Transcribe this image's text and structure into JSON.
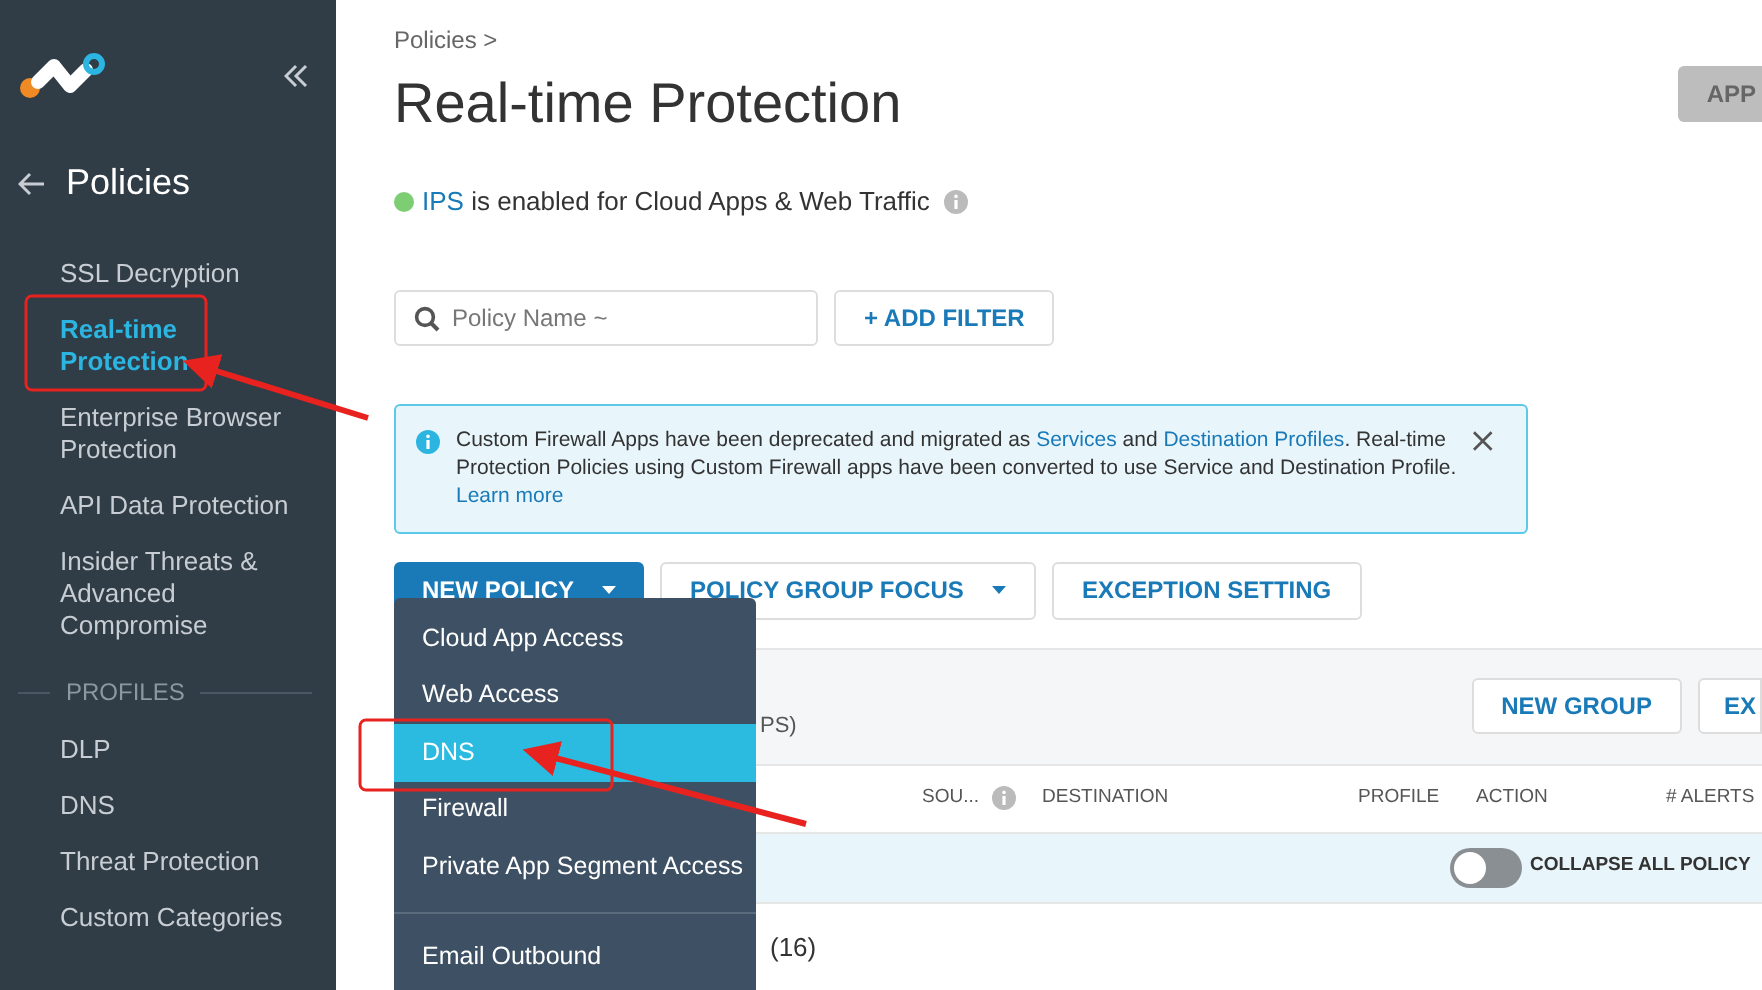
{
  "sidebar": {
    "section_title": "Policies",
    "items": [
      {
        "label": "SSL Decryption",
        "selected": false
      },
      {
        "label": "Real-time Protection",
        "selected": true
      },
      {
        "label": "Enterprise Browser Protection",
        "selected": false
      },
      {
        "label": "API Data Protection",
        "selected": false
      },
      {
        "label": "Insider Threats & Advanced Compromise",
        "selected": false
      }
    ],
    "profiles_heading": "PROFILES",
    "profile_items": [
      {
        "label": "DLP",
        "selected": false
      },
      {
        "label": "DNS",
        "selected": false
      },
      {
        "label": "Threat Protection",
        "selected": false
      },
      {
        "label": "Custom Categories",
        "selected": false
      }
    ]
  },
  "breadcrumb": "Policies >",
  "title": "Real-time Protection",
  "top_button": "APP",
  "status": {
    "enabled": true,
    "link": "IPS",
    "text": "is enabled for Cloud Apps & Web Traffic"
  },
  "search": {
    "placeholder": "Policy Name ~"
  },
  "filter_button": "+ ADD FILTER",
  "notice": {
    "segments": [
      {
        "text": "Custom Firewall Apps have been deprecated and migrated as ",
        "link": false
      },
      {
        "text": "Services",
        "link": true
      },
      {
        "text": " and ",
        "link": false
      },
      {
        "text": "Destination Profiles",
        "link": true
      },
      {
        "text": ". Real-time Protection Policies using Custom Firewall apps have been converted to use Service and Destination Profile. ",
        "link": false
      },
      {
        "text": "Learn more",
        "link": true
      }
    ]
  },
  "actions": [
    {
      "label": "NEW POLICY",
      "kind": "primary",
      "dropdown": true
    },
    {
      "label": "POLICY GROUP FOCUS",
      "kind": "outline",
      "dropdown": true
    },
    {
      "label": "EXCEPTION SETTING",
      "kind": "outline",
      "dropdown": false
    }
  ],
  "menu": {
    "groups": [
      [
        {
          "label": "Cloud App Access",
          "selected": false
        },
        {
          "label": "Web Access",
          "selected": false
        },
        {
          "label": "DNS",
          "selected": true
        },
        {
          "label": "Firewall",
          "selected": false
        },
        {
          "label": "Private App Segment Access",
          "selected": false
        }
      ],
      [
        {
          "label": "Email Outbound",
          "selected": false
        }
      ]
    ]
  },
  "table": {
    "group_count_fragment": "PS)",
    "buttons": [
      "NEW GROUP",
      "EX"
    ],
    "columns": [
      {
        "label": "SOU...",
        "kind": "with_info"
      },
      {
        "label": "DESTINATION",
        "kind": "plain"
      },
      {
        "label": "PROFILE",
        "kind": "plain"
      },
      {
        "label": "ACTION",
        "kind": "plain"
      },
      {
        "label": "# ALERTS",
        "kind": "plain"
      }
    ],
    "collapse_toggle": {
      "label": "COLLAPSE ALL POLICY",
      "on": false
    },
    "group_row_count": "(16)"
  }
}
